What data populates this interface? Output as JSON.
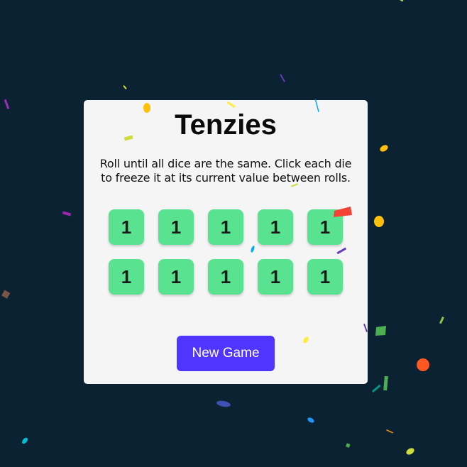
{
  "game": {
    "title": "Tenzies",
    "instructions": "Roll until all dice are the same. Click each die to freeze it at its current value between rolls.",
    "new_game_label": "New Game"
  },
  "dice": [
    {
      "value": "1",
      "held": true
    },
    {
      "value": "1",
      "held": true
    },
    {
      "value": "1",
      "held": true
    },
    {
      "value": "1",
      "held": true
    },
    {
      "value": "1",
      "held": true
    },
    {
      "value": "1",
      "held": true
    },
    {
      "value": "1",
      "held": true
    },
    {
      "value": "1",
      "held": true
    },
    {
      "value": "1",
      "held": true
    },
    {
      "value": "1",
      "held": true
    }
  ],
  "colors": {
    "background": "#0b2233",
    "card": "#f5f5f5",
    "die_held": "#59e391",
    "button": "#5035ff"
  }
}
